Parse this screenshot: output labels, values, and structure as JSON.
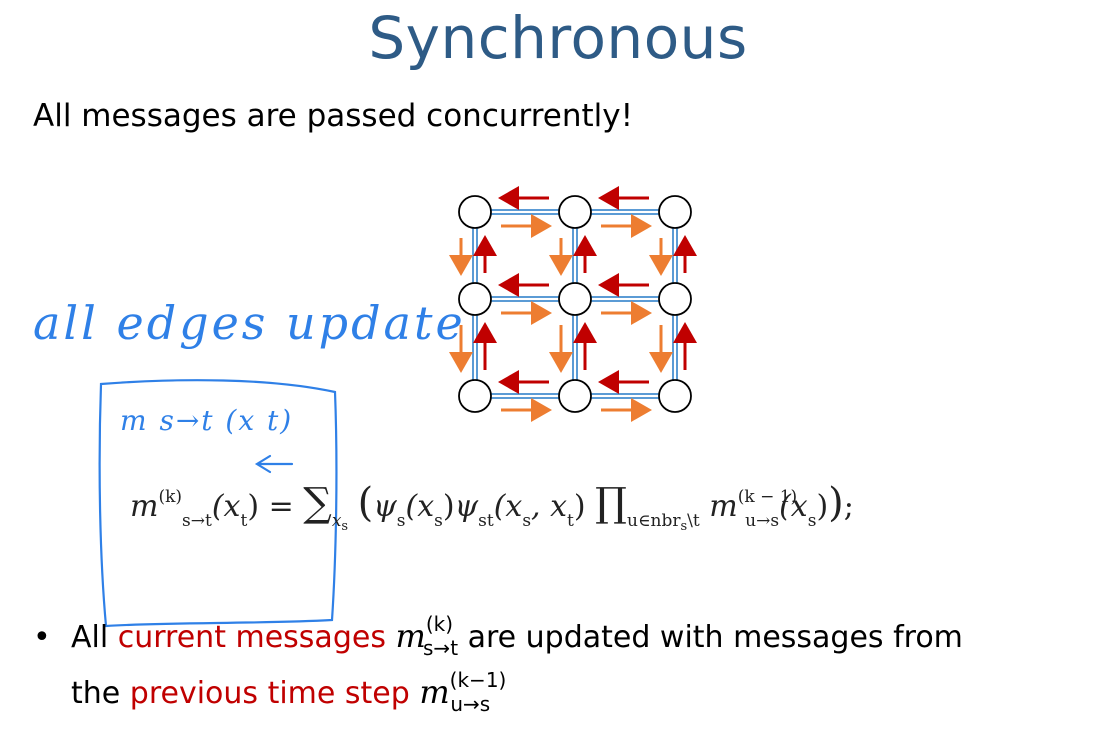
{
  "slide": {
    "title": "Synchronous",
    "subtitle": "All messages are passed concurrently!"
  },
  "annotations": {
    "handwritten_note": "all edges update",
    "handwritten_label": "m s→t (x t)"
  },
  "formula": {
    "lhs_m": "m",
    "lhs_sup": "(k)",
    "lhs_sub": "s→t",
    "lhs_arg": "(x",
    "lhs_arg_sub": "t",
    "lhs_close": ")",
    "equals": "=",
    "sum": "∑",
    "sum_sub": "x",
    "sum_sub_sub": "s",
    "open": "(",
    "psi_s": "ψ",
    "psi_s_sub": "s",
    "psi_s_arg": "(x",
    "psi_s_arg_sub": "s",
    "psi_s_close": ")",
    "psi_st": "ψ",
    "psi_st_sub": "st",
    "psi_st_arg": "(x",
    "psi_st_arg_sub": "s",
    "psi_st_comma": ", x",
    "psi_st_arg_sub2": "t",
    "psi_st_close": ")",
    "prod": "∏",
    "prod_sub": "u∈nbr",
    "prod_sub_sub": "s",
    "prod_sub_rest": "\\t",
    "m_in": "m",
    "m_in_sup": "(k − 1)",
    "m_in_sub": "u→s",
    "m_in_arg": "(x",
    "m_in_arg_sub": "s",
    "m_in_close": ")",
    "close": ")",
    "semicolon": ";"
  },
  "bullets": {
    "dot": "•",
    "line1_a": "All ",
    "line1_red": "current messages ",
    "line1_m": "m",
    "line1_sup": "(k)",
    "line1_sub": "s→t",
    "line1_b": " are updated with messages from",
    "line2_a": "the ",
    "line2_red": "previous time step ",
    "line2_m": "m",
    "line2_sup": "(k−1)",
    "line2_sub": "u→s"
  },
  "colors": {
    "title": "#2e5b86",
    "edge": "#5b9bd5",
    "arrow_left_up": "#c00000",
    "arrow_right_down": "#ed7d31",
    "ink": "#2f80e7",
    "highlight_text": "#c00000"
  }
}
